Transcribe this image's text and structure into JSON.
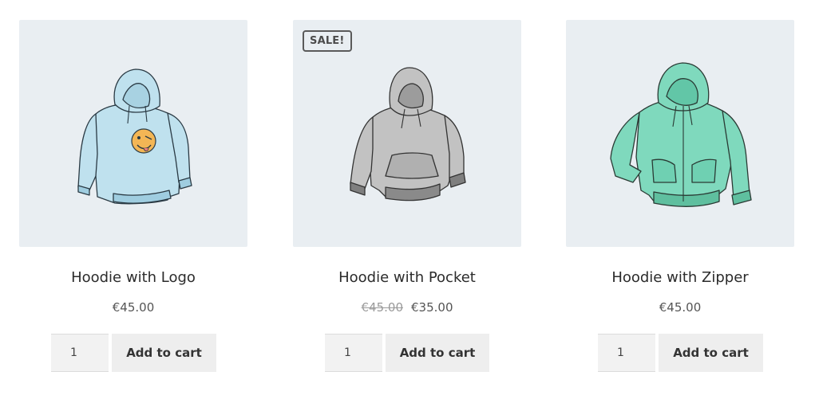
{
  "products": [
    {
      "title": "Hoodie with Logo",
      "price": "€45.00",
      "quantity": "1",
      "button_label": "Add to cart",
      "image_icon": "hoodie-logo-icon",
      "color": "#bfe1ee"
    },
    {
      "badge": "SALE!",
      "title": "Hoodie with Pocket",
      "old_price": "€45.00",
      "price": "€35.00",
      "quantity": "1",
      "button_label": "Add to cart",
      "image_icon": "hoodie-pocket-icon",
      "color": "#bdbdbd"
    },
    {
      "title": "Hoodie with Zipper",
      "price": "€45.00",
      "quantity": "1",
      "button_label": "Add to cart",
      "image_icon": "hoodie-zipper-icon",
      "color": "#7fd9bd"
    }
  ]
}
